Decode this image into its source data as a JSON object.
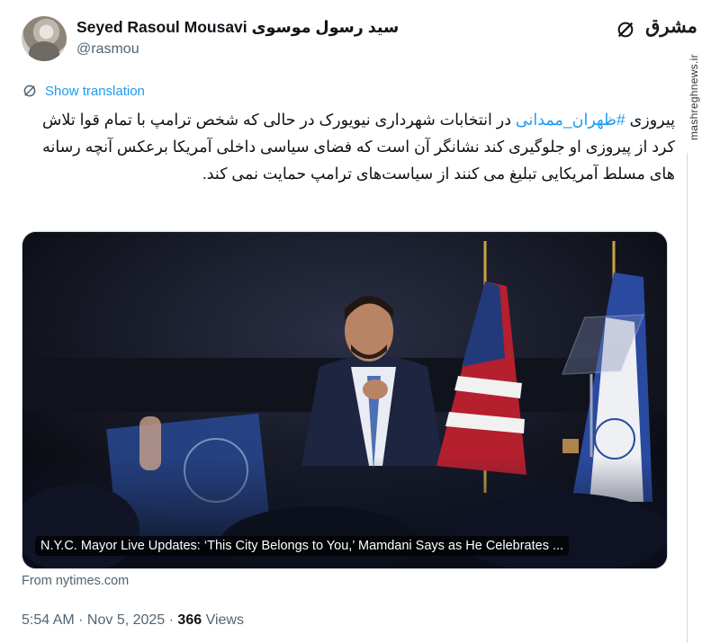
{
  "author": {
    "name": "Seyed Rasoul Mousavi سید رسول موسوی",
    "handle": "@rasmou"
  },
  "publisher": {
    "logo_text": "مشرق",
    "watermark": "mashreghnews.ir"
  },
  "translate_label": "Show translation",
  "tweet": {
    "prefix": "پیروزی ",
    "hashtag": "#ظهران_ممدانی",
    "body": " در انتخابات شهرداری نیویورک در حالی که شخص ترامپ با تمام قوا تلاش کرد از پیروزی او جلوگیری کند نشانگر آن است که فضای سیاسی داخلی آمریکا برعکس آنچه رسانه های مسلط آمریکایی تبلیغ می کنند از سیاست‌های ترامپ حمایت نمی کند."
  },
  "card": {
    "caption": "N.Y.C. Mayor Live Updates: ‘This City Belongs to You,’ Mamdani Says as He Celebrates ...",
    "source": "From nytimes.com"
  },
  "meta": {
    "time": "5:54 AM · Nov 5, 2025 · ",
    "views_count": "366",
    "views_label": " Views"
  },
  "colors": {
    "link": "#1d9bf0",
    "text": "#0f1419",
    "muted": "#536471"
  },
  "icons": [
    "grok-icon",
    "translate-icon"
  ]
}
